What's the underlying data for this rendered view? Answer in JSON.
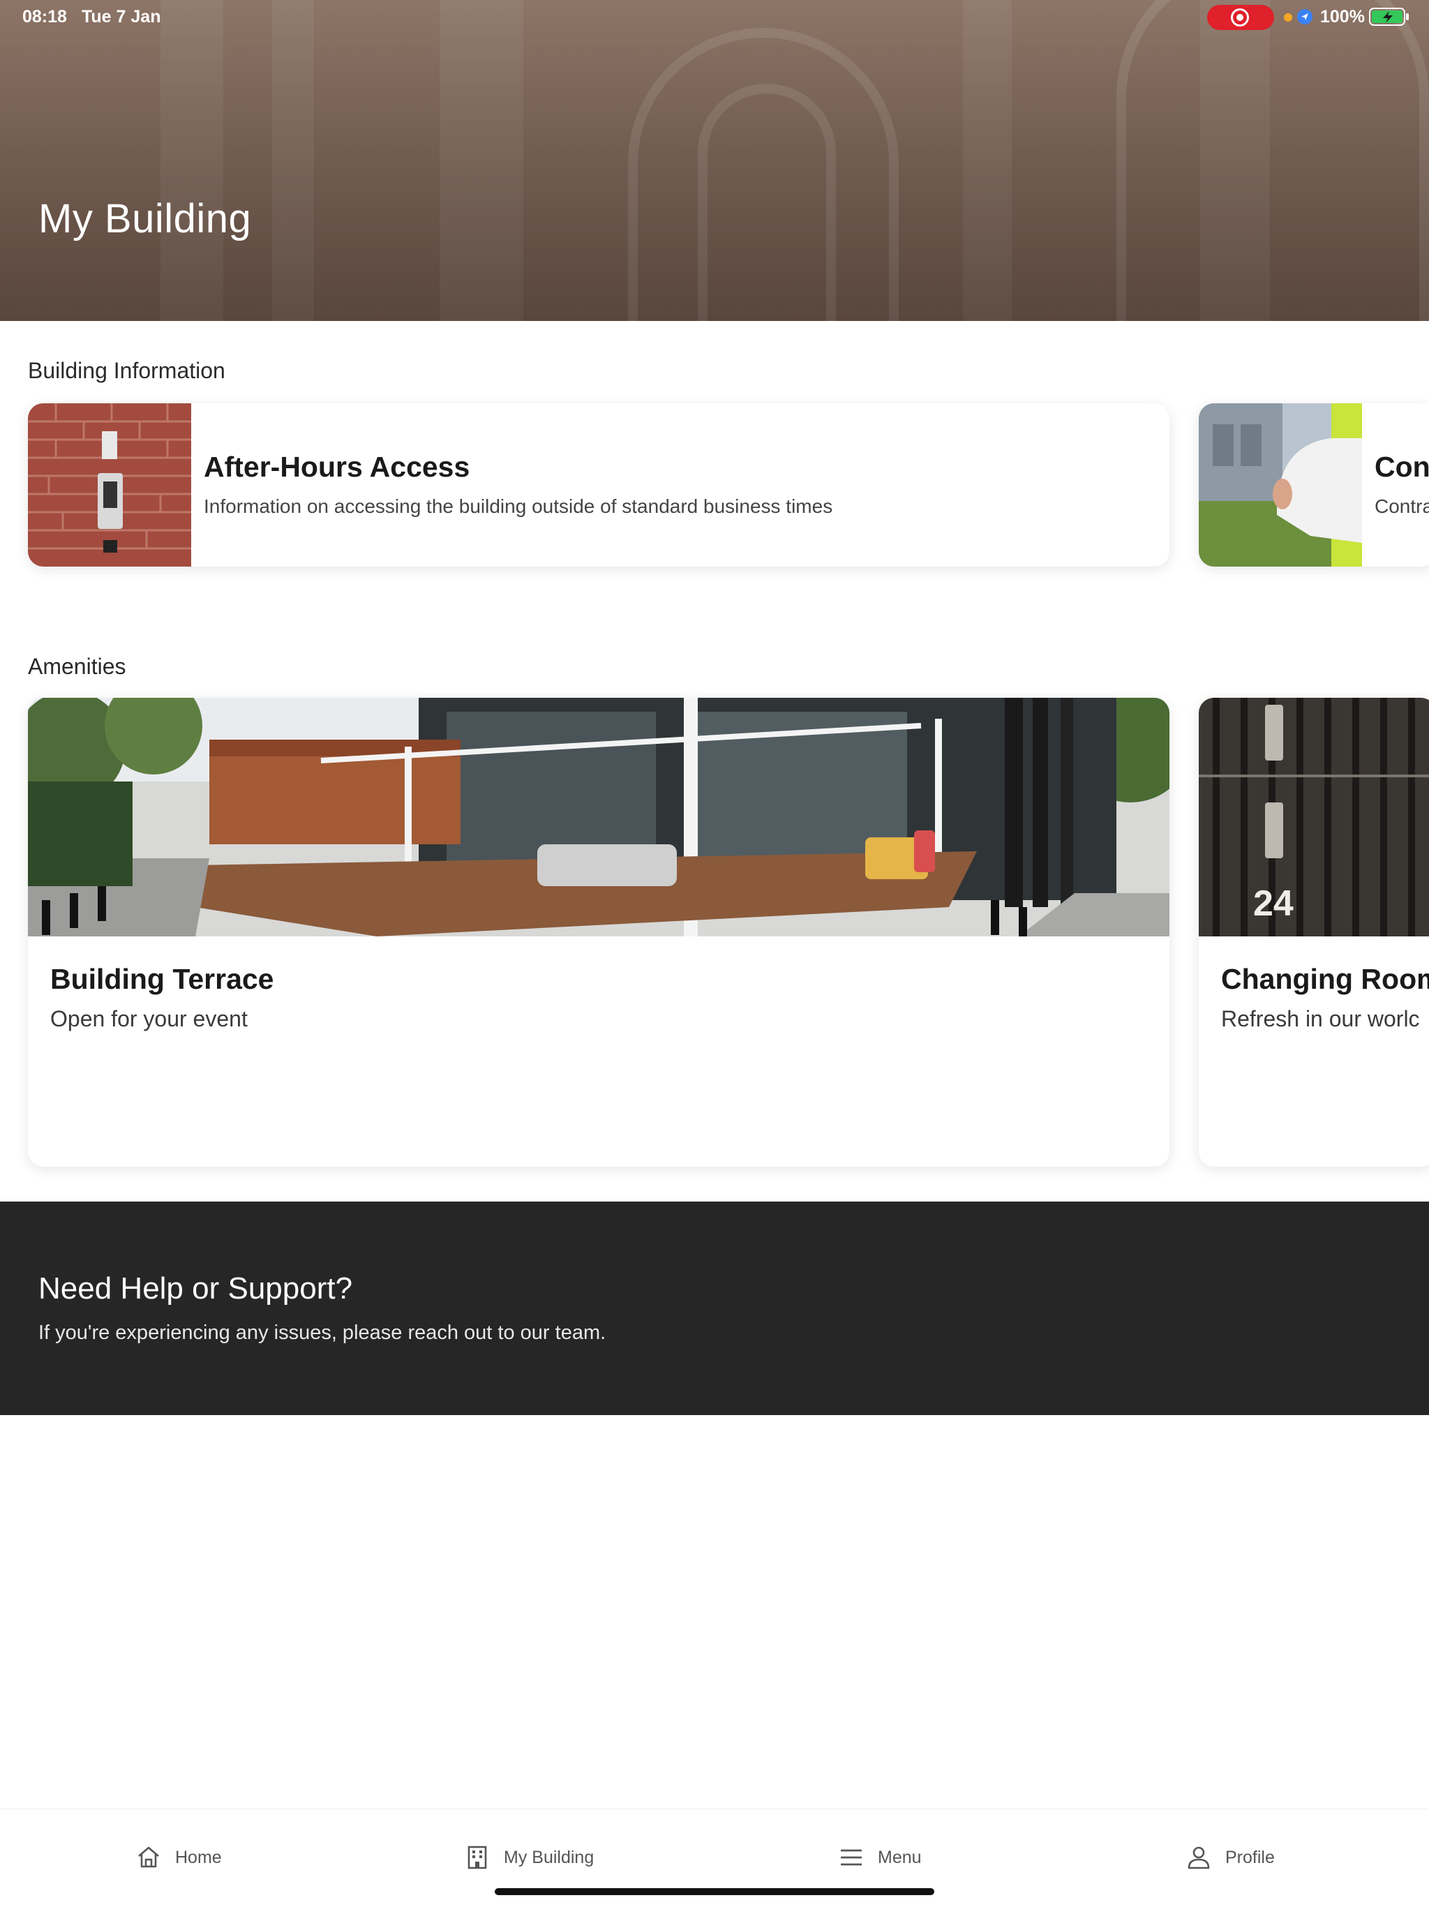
{
  "status_bar": {
    "time": "08:18",
    "date": "Tue 7 Jan",
    "battery": "100%",
    "icons": [
      "screen-recording-icon",
      "location-icon",
      "battery-charging-icon"
    ],
    "recording_color": "#e0202a",
    "battery_color": "#34c759"
  },
  "header": {
    "title": "My Building"
  },
  "building_information": {
    "label": "Building Information",
    "cards": [
      {
        "title": "After-Hours Access",
        "description": "Information on accessing the building outside of standard business times",
        "image": "access-keypad-on-brick-wall"
      },
      {
        "title": "Con",
        "description": "Contra",
        "image": "hard-hat-at-construction-site"
      }
    ]
  },
  "amenities": {
    "label": "Amenities",
    "cards": [
      {
        "title": "Building Terrace",
        "subtitle": "Open for your event",
        "image": "outdoor-terrace-seating"
      },
      {
        "title": "Changing Room",
        "subtitle": "Refresh in our worlc",
        "image": "lockers",
        "locker_number": "24"
      }
    ]
  },
  "support": {
    "title": "Need Help or Support?",
    "text": "If you're experiencing any issues, please reach out to our team.",
    "background": "#262626"
  },
  "tab_bar": {
    "items": [
      {
        "label": "Home",
        "icon": "home-icon"
      },
      {
        "label": "My Building",
        "icon": "building-icon",
        "active": true
      },
      {
        "label": "Menu",
        "icon": "menu-icon"
      },
      {
        "label": "Profile",
        "icon": "profile-icon"
      }
    ]
  }
}
